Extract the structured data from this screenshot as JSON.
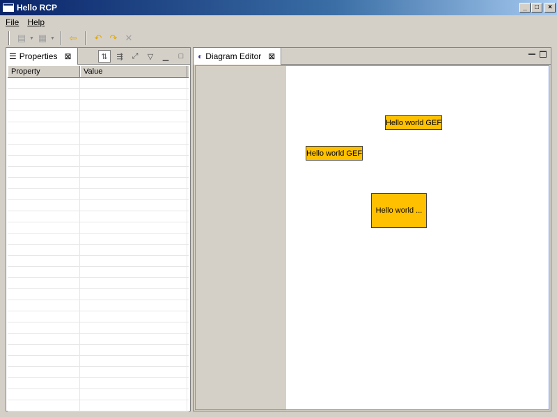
{
  "window": {
    "title": "Hello RCP"
  },
  "menu": {
    "file": "File",
    "help": "Help"
  },
  "properties_view": {
    "tab_label": "Properties",
    "columns": [
      "Property",
      "Value"
    ],
    "row_count": 30
  },
  "editor": {
    "tab_label": "Diagram Editor",
    "nodes": [
      {
        "label": "Hello world GEF"
      },
      {
        "label": "Hello world GEF"
      },
      {
        "label": "Hello world ..."
      }
    ]
  },
  "colors": {
    "node_fill": "#ffc000",
    "title_gradient_start": "#0a246a"
  }
}
